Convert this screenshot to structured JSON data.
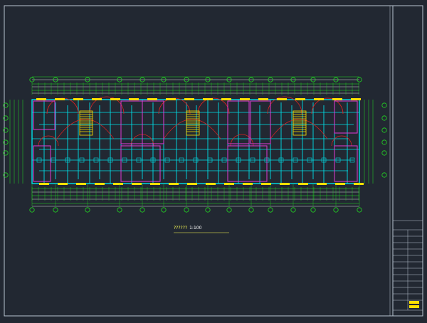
{
  "drawing": {
    "title": "??????",
    "scale": "1:100",
    "colors": {
      "background": "#222832",
      "frame": "#b8c4d0",
      "wall": "#00e0e8",
      "axis": "#22dd22",
      "door_arc": "#dd2222",
      "window": "#ffe000",
      "stair": "#ffe000",
      "furniture": "#e03ad6",
      "dimension_text": "#ffffff",
      "title_text": "#ffff55"
    },
    "grid_axes_bottom": [
      "1",
      "3",
      "5",
      "7",
      "9",
      "11",
      "13",
      "15",
      "17",
      "19",
      "21",
      "23"
    ],
    "grid_axes_side": [
      "A",
      "B",
      "C",
      "D",
      "E",
      "F",
      "G"
    ]
  }
}
